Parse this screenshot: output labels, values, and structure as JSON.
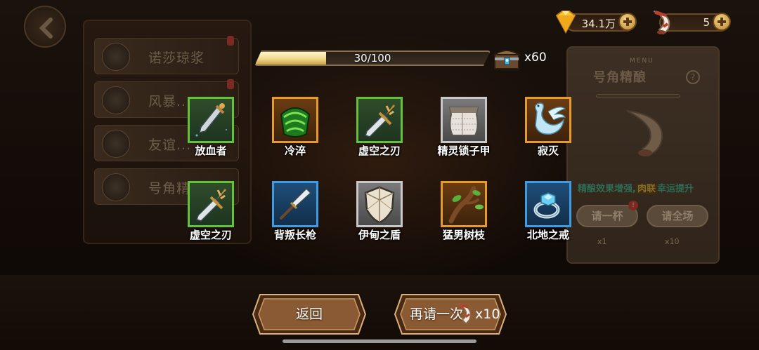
{
  "currency": {
    "diamonds": "34.1万",
    "horns": "5"
  },
  "progress": {
    "text": "30/100",
    "fraction": 0.3,
    "chest_count": "x60"
  },
  "items": [
    {
      "name": "放血者",
      "rarity": "green",
      "icon": "dagger-icon"
    },
    {
      "name": "冷淬",
      "rarity": "orange",
      "icon": "green-armor-icon"
    },
    {
      "name": "虚空之刃",
      "rarity": "green",
      "icon": "void-blade-icon"
    },
    {
      "name": "精灵锁子甲",
      "rarity": "grey",
      "icon": "chainmail-icon"
    },
    {
      "name": "寂灭",
      "rarity": "orange",
      "icon": "swan-wing-icon"
    },
    {
      "name": "虚空之刃",
      "rarity": "green",
      "icon": "void-blade-icon"
    },
    {
      "name": "背叛长枪",
      "rarity": "blue",
      "icon": "spear-icon"
    },
    {
      "name": "伊甸之盾",
      "rarity": "grey",
      "icon": "shield-icon"
    },
    {
      "name": "猛男树枝",
      "rarity": "orange",
      "icon": "tree-branch-icon"
    },
    {
      "name": "北地之戒",
      "rarity": "blue",
      "icon": "ring-icon"
    }
  ],
  "buttons": {
    "back": "返回",
    "again": "再请一次",
    "again_cost": "x10"
  },
  "background": {
    "menu_items": [
      "诺莎琼浆",
      "风暴...",
      "友谊...",
      "号角精..."
    ],
    "menu_word": "MENU",
    "drink_name": "号角精酿",
    "help": "?",
    "buff_text": "精酿效果增强,",
    "buff_highlight": "肉联",
    "buff_text_tail": "幸运提升",
    "btn_one": "请一杯",
    "btn_all": "请全场",
    "cost_one": "x1",
    "cost_all": "x10"
  },
  "colors": {
    "green": "#62c33b",
    "orange": "#e59a2a",
    "grey": "#c8c8c8",
    "blue": "#3f9be3",
    "progress_fill": "#f1d98a",
    "button_brown": "#8a5a34"
  }
}
